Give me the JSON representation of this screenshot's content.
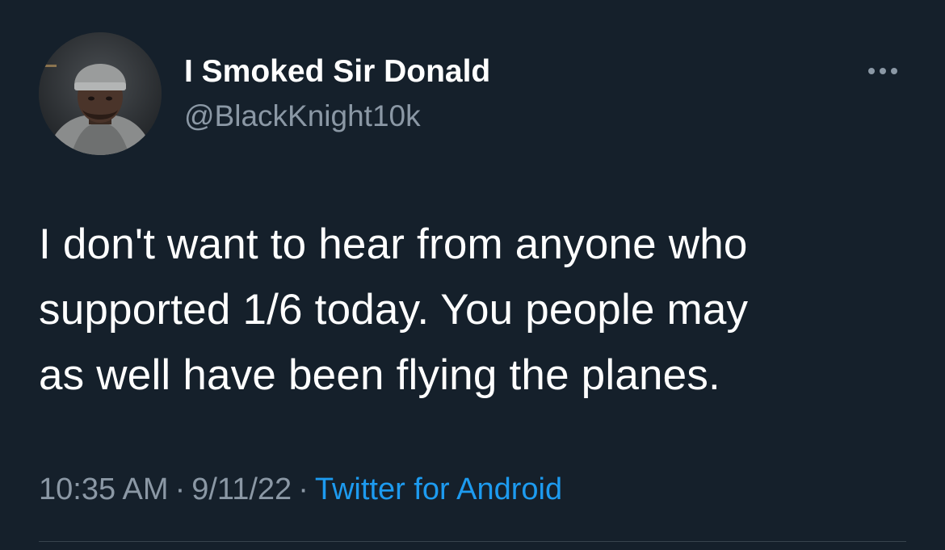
{
  "tweet": {
    "author": {
      "display_name": "I Smoked Sir Donald",
      "handle": "@BlackKnight10k",
      "avatar_icon": "profile-photo"
    },
    "more_icon": "more-options-icon",
    "text_lines": [
      "I don't want to hear from anyone who",
      "supported 1/6 today. You people may",
      "as well have been flying the planes."
    ],
    "time": "10:35 AM",
    "separator": "·",
    "date": "9/11/22",
    "source": "Twitter for Android"
  },
  "colors": {
    "background": "#15202b",
    "primary_text": "#ffffff",
    "secondary_text": "#8b98a5",
    "link": "#1d9bf0",
    "divider": "#38444d"
  }
}
